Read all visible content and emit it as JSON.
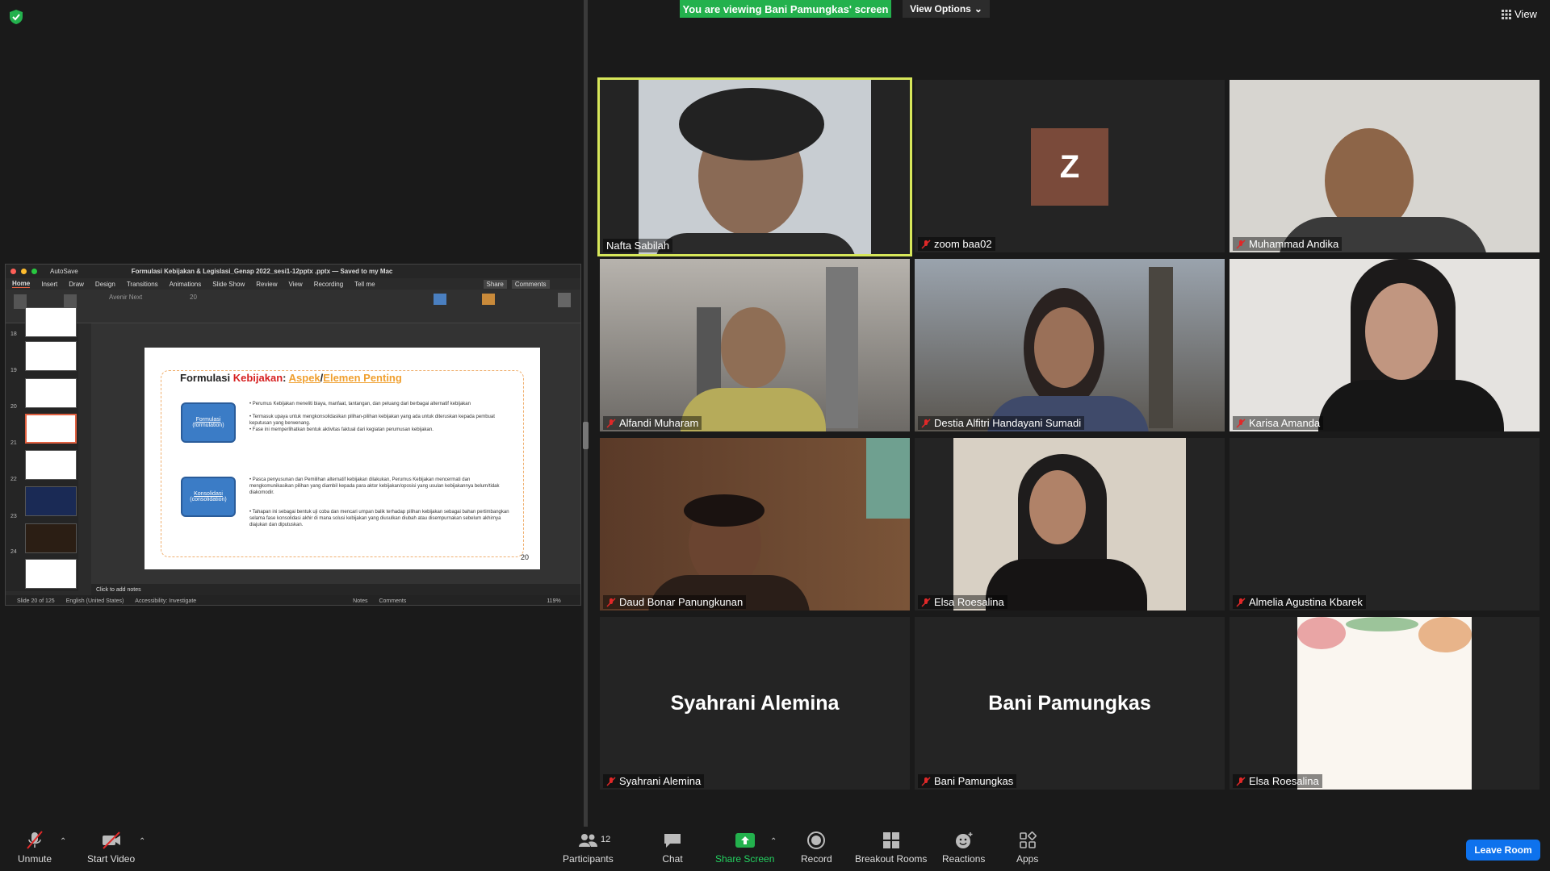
{
  "top": {
    "banner": "You are viewing Bani Pamungkas' screen",
    "view_options": "View Options",
    "view_label": "View"
  },
  "ppt": {
    "autosave": "AutoSave",
    "file_title": "Formulasi Kebijakan & Legislasi_Genap 2022_sesi1-12pptx .pptx — Saved to my Mac",
    "tabs": [
      "Home",
      "Insert",
      "Draw",
      "Design",
      "Transitions",
      "Animations",
      "Slide Show",
      "Review",
      "View",
      "Recording",
      "Tell me"
    ],
    "share": "Share",
    "comments": "Comments",
    "font_name": "Avenir Next",
    "font_size": "20",
    "thumb_numbers": [
      "18",
      "19",
      "20",
      "21",
      "22",
      "23",
      "24"
    ],
    "slide": {
      "title_part1": "Formulasi ",
      "title_part2": "Kebijakan",
      "title_part3": ": ",
      "title_part4": "Aspek",
      "title_part5": "/",
      "title_part6": "Elemen Penting",
      "box1_line1": "Formulasi",
      "box1_line2": "(formulation)",
      "box2_line1": "Konsolidasi",
      "box2_line2": "(consolidation)",
      "bullet1": "Perumus Kebijakan meneliti biaya, manfaat, tantangan, dan peluang dari berbagai alternatif kebijakan",
      "bullet2": "Termasuk upaya untuk mengkonsolidasikan pilihan-pilihan kebijakan yang ada untuk diteruskan kepada pembuat keputusan yang berwenang.",
      "bullet3": "Fase ini memperlihatkan bentuk aktivitas faktual dari kegiatan perumusan kebijakan.",
      "bullet4": "Pasca penyusunan dan Pemilihan alternatif kebijakan dilakukan, Perumus Kebijakan mencermati dan mengkomunikasikan pilihan yang diambil kepada para aktor kebijakan/oposisi yang usulan kebijakannya belum/tidak diakomodir.",
      "bullet5": "Tahapan ini sebagai bentuk uji coba dan mencari umpan balik terhadap pilihan kebijakan sebagai bahan pertimbangkan selama fase konsolidasi akhir di mana solusi kebijakan yang diusulkan diubah atau disempurnakan sebelum akhirnya diajukan dan diputuskan.",
      "number": "20"
    },
    "notes": "Click to add notes",
    "status_slide": "Slide 20 of 125",
    "status_lang": "English (United States)",
    "status_access": "Accessibility: Investigate",
    "status_notes": "Notes",
    "status_comments": "Comments",
    "zoom": "119%"
  },
  "participants": [
    {
      "name": "Nafta Sabilah",
      "muted": false
    },
    {
      "name": "zoom baa02",
      "muted": true,
      "initial": "Z"
    },
    {
      "name": "Muhammad Andika",
      "muted": true
    },
    {
      "name": "Alfandi Muharam",
      "muted": true
    },
    {
      "name": "Destia Alfitri Handayani Sumadi",
      "muted": true
    },
    {
      "name": "Karisa Amanda",
      "muted": true
    },
    {
      "name": "Daud Bonar Panungkunan",
      "muted": true
    },
    {
      "name": "Elsa Roesalina",
      "muted": true
    },
    {
      "name": "Almelia Agustina Kbarek",
      "muted": true
    },
    {
      "name": "Syahrani Alemina",
      "muted": true,
      "big": "Syahrani Alemina"
    },
    {
      "name": "Bani Pamungkas",
      "muted": true,
      "big": "Bani Pamungkas"
    },
    {
      "name": "Elsa Roesalina",
      "muted": true
    }
  ],
  "toolbar": {
    "unmute": "Unmute",
    "start_video": "Start Video",
    "participants": "Participants",
    "participants_count": "12",
    "chat": "Chat",
    "share_screen": "Share Screen",
    "record": "Record",
    "breakout": "Breakout Rooms",
    "reactions": "Reactions",
    "apps": "Apps",
    "leave": "Leave Room"
  },
  "colors": {
    "banner_green": "#23b14d",
    "active_speaker": "#d7e75a",
    "leave_blue": "#0e72ed",
    "mute_red": "#e02828"
  }
}
